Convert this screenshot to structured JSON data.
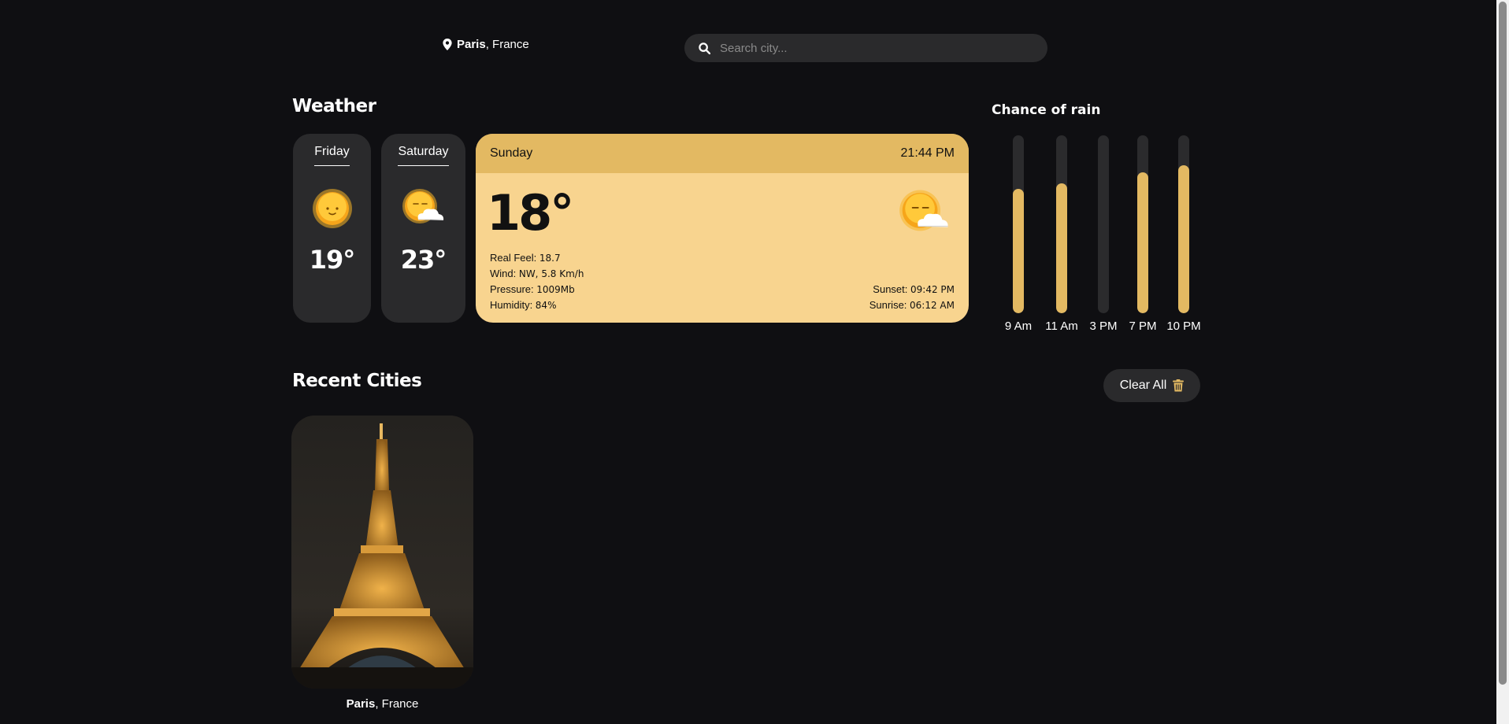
{
  "header": {
    "city": "Paris",
    "country": ", France",
    "search_placeholder": "Search city..."
  },
  "weather": {
    "title": "Weather",
    "forecast": [
      {
        "day": "Friday",
        "temp": "19°",
        "icon": "sunny-icon"
      },
      {
        "day": "Saturday",
        "temp": "23°",
        "icon": "partly-cloudy-icon"
      }
    ],
    "today": {
      "day": "Sunday",
      "time": "21:44 PM",
      "temp": "18°",
      "icon": "partly-cloudy-icon",
      "real_feel_label": "Real Feel: ",
      "real_feel": "18.7",
      "wind_label": "Wind: ",
      "wind": "NW, 5.8 Km/h",
      "pressure_label": "Pressure: ",
      "pressure": "1009Mb",
      "humidity_label": "Humidity: ",
      "humidity": "84%",
      "sunset_label": "Sunset: ",
      "sunset": "09:42 PM",
      "sunrise_label": "Sunrise: ",
      "sunrise": "06:12 AM"
    }
  },
  "rain": {
    "title": "Chance of rain",
    "slots": [
      {
        "label": "9 Am",
        "level": 0.7
      },
      {
        "label": "11 Am",
        "level": 0.73
      },
      {
        "label": "3 PM",
        "level": 0.0
      },
      {
        "label": "7 PM",
        "level": 0.79
      },
      {
        "label": "10 PM",
        "level": 0.83
      }
    ]
  },
  "recent": {
    "title": "Recent Cities",
    "clear_label": "Clear All",
    "cities": [
      {
        "city": "Paris",
        "country": ", France"
      }
    ]
  },
  "colors": {
    "background": "#0f0f12",
    "card": "#2a2a2c",
    "accent": "#e3b962",
    "today_card": "#f8d48f"
  }
}
